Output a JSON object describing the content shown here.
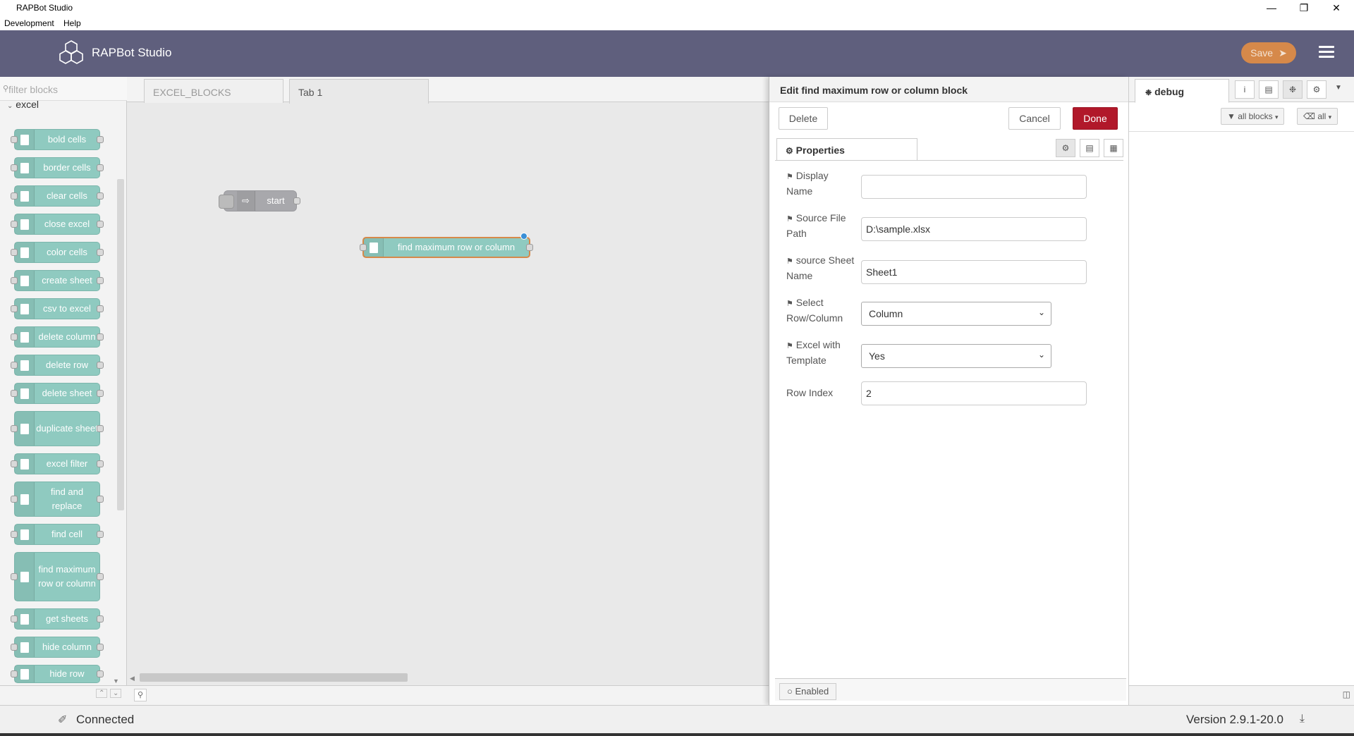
{
  "window": {
    "title": "RAPBot Studio"
  },
  "menu": [
    "Development",
    "Help"
  ],
  "header": {
    "brand": "RAPBot Studio",
    "save_label": "Save"
  },
  "palette": {
    "filter_placeholder": "filter blocks",
    "category": "excel",
    "nodes": [
      "bold cells",
      "border cells",
      "clear cells",
      "close excel",
      "color cells",
      "create sheet",
      "csv to excel",
      "delete column",
      "delete row",
      "delete sheet",
      "duplicate sheet",
      "excel filter",
      "find and replace",
      "find cell",
      "find maximum row or column",
      "get sheets",
      "hide column",
      "hide row"
    ]
  },
  "workspace": {
    "tabs": [
      "EXCEL_BLOCKS",
      "Tab 1"
    ],
    "flow_nodes": {
      "start": "start",
      "find": "find maximum row or column"
    }
  },
  "editor": {
    "title": "Edit find maximum row or column block",
    "delete_label": "Delete",
    "cancel_label": "Cancel",
    "done_label": "Done",
    "properties_tab": "Properties",
    "fields": {
      "display_name": {
        "label": "Display Name",
        "value": ""
      },
      "source_file_path": {
        "label": "Source File Path",
        "value": "D:\\sample.xlsx"
      },
      "source_sheet_name": {
        "label": "source Sheet Name",
        "value": "Sheet1"
      },
      "select_row_column": {
        "label": "Select Row/Column",
        "value": "Column"
      },
      "excel_with_template": {
        "label": "Excel with Template",
        "value": "Yes"
      },
      "row_index": {
        "label": "Row Index",
        "value": "2"
      }
    },
    "enabled_label": "Enabled"
  },
  "sidebar": {
    "tab": "debug",
    "filter_label": "all blocks",
    "clear_label": "all"
  },
  "status": {
    "connection": "Connected",
    "version": "Version 2.9.1-20.0"
  },
  "colors": {
    "header_bg": "#5f5f7d",
    "save_bg": "#d6894a",
    "done_bg": "#b1182a",
    "node_bg": "#8fcac0"
  }
}
